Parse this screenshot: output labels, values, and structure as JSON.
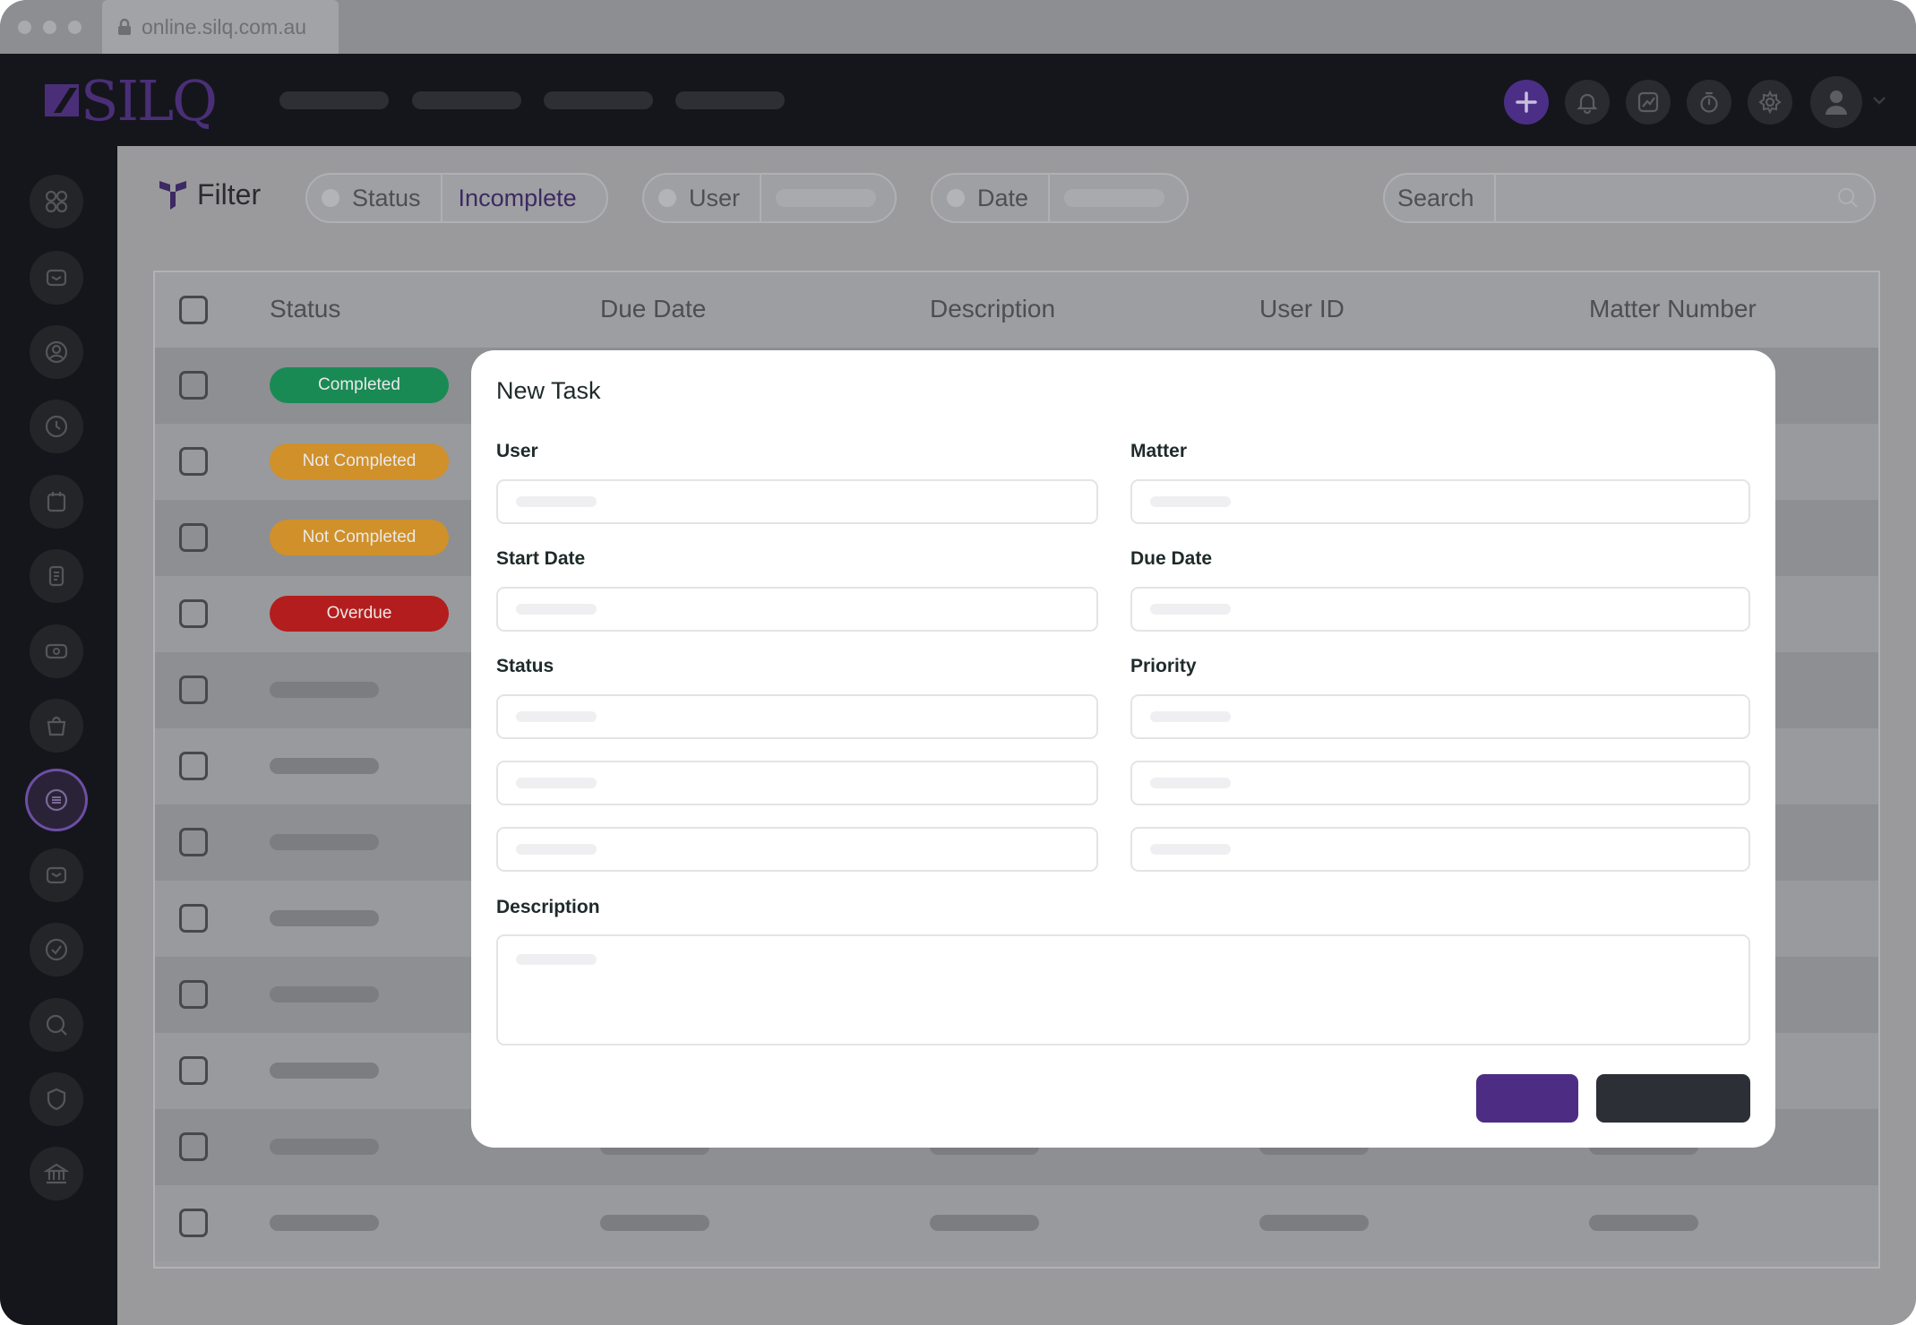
{
  "browser": {
    "url": "online.silq.com.au"
  },
  "app": {
    "logo": "SILQ"
  },
  "filter": {
    "label": "Filter",
    "status_label": "Status",
    "status_value": "Incomplete",
    "user_label": "User",
    "date_label": "Date",
    "search_label": "Search"
  },
  "table": {
    "columns": [
      "Status",
      "Due Date",
      "Description",
      "User ID",
      "Matter Number"
    ],
    "rows": [
      {
        "status": "Completed",
        "color": "#1a8a55"
      },
      {
        "status": "Not Completed",
        "color": "#d0902a"
      },
      {
        "status": "Not Completed",
        "color": "#d0902a"
      },
      {
        "status": "Overdue",
        "color": "#b41d1d"
      }
    ]
  },
  "modal": {
    "title": "New Task",
    "fields": {
      "user": "User",
      "matter": "Matter",
      "start_date": "Start Date",
      "due_date": "Due Date",
      "status": "Status",
      "priority": "Priority",
      "description": "Description"
    }
  },
  "colors": {
    "accent": "#4d2d84",
    "sidebar": "#15161b"
  },
  "icons": {
    "sidebar": [
      "dashboard-icon",
      "inbox-icon",
      "contacts-icon",
      "clock-icon",
      "calendar-icon",
      "document-icon",
      "billing-icon",
      "bag-icon",
      "tasks-icon",
      "mail-icon",
      "check-icon",
      "search-icon",
      "shield-icon",
      "bank-icon"
    ],
    "header": [
      "plus-icon",
      "bell-icon",
      "chart-icon",
      "timer-icon",
      "settings-icon",
      "user-avatar-icon"
    ]
  }
}
